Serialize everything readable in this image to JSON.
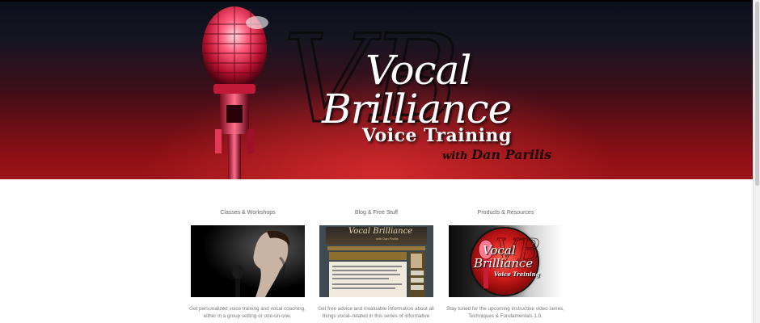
{
  "hero": {
    "title_line1": "Vocal",
    "title_line2": "Brilliance",
    "subtitle": "Voice Training",
    "byline_prefix": "with",
    "byline_name": "Dan Parilis",
    "monogram": "VB"
  },
  "features": [
    {
      "title": "Classes & Workshops",
      "image": "singer-with-microphone",
      "text": "Get personalized voice training and vocal coaching, either in a group setting or one-on-one."
    },
    {
      "title": "Blog & Free Stuff",
      "image": "blog-screenshot",
      "blog_title": "Vocal Brilliance",
      "blog_sub": "with Dan Parilis",
      "text": "Get free advice and invaluable information about all things vocal–related in this series of informative"
    },
    {
      "title": "Products & Resources",
      "image": "logo-medallion",
      "medallion": {
        "line1": "Vocal",
        "line2": "Brilliance",
        "line3": "Voice Training"
      },
      "text": "Stay tuned for the upcoming instructive video series, Techniques & Fundamentals 1.0."
    }
  ],
  "colors": {
    "hero_top": "#0b0f1a",
    "hero_bottom": "#9a1418",
    "text_muted": "#777777"
  }
}
